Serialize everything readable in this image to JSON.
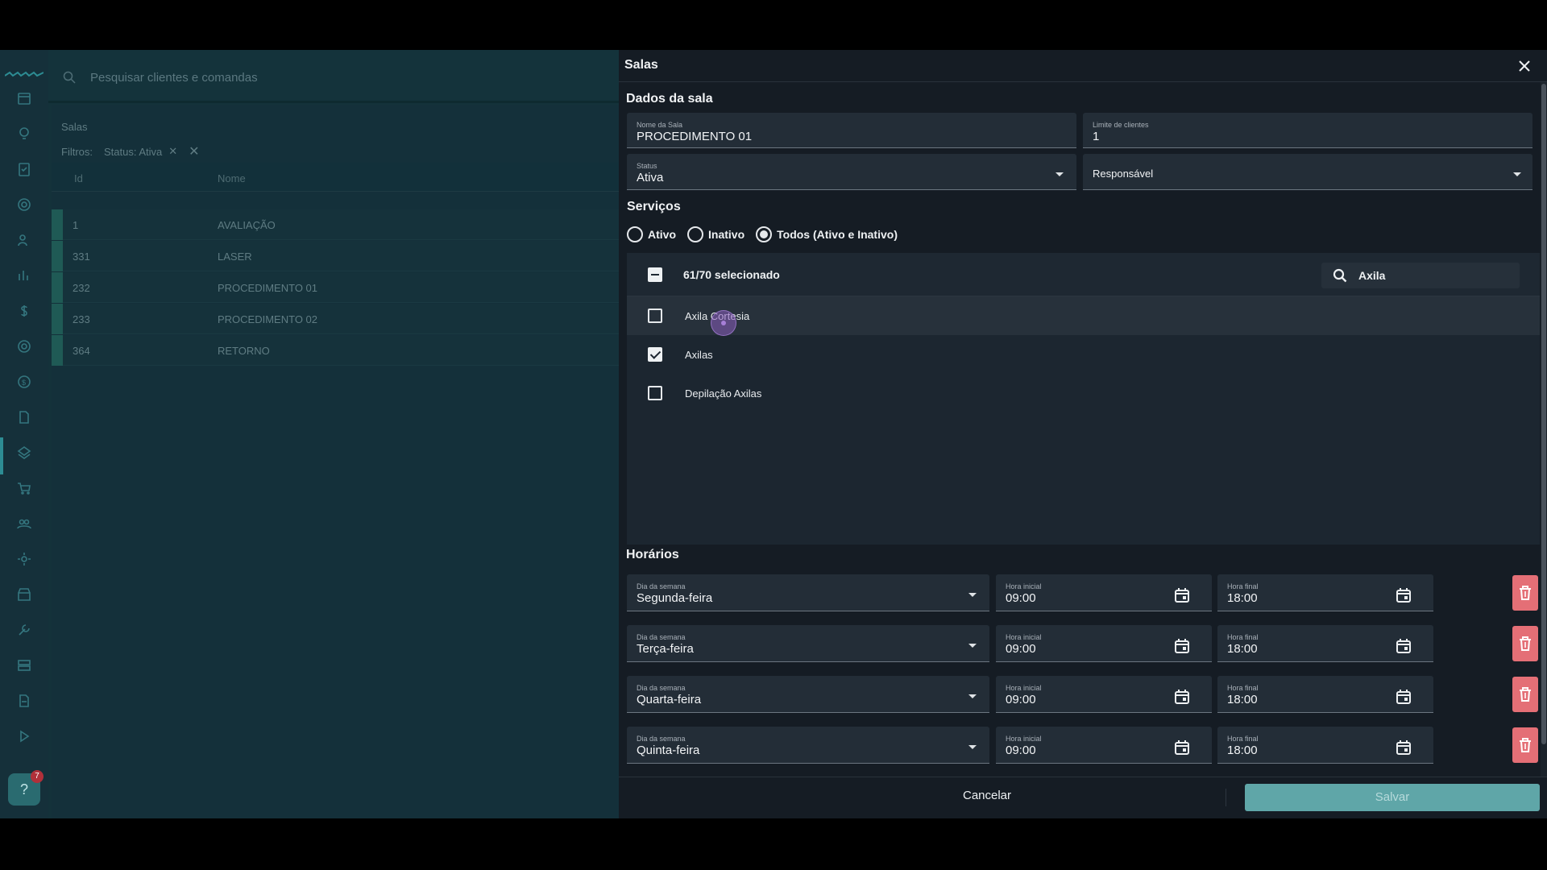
{
  "search": {
    "placeholder": "Pesquisar clientes e comandas"
  },
  "rail": {
    "help_badge": "7"
  },
  "background_page": {
    "title": "Salas",
    "filters_label": "Filtros:",
    "filter_chip": "Status: Ativa",
    "columns": [
      "Id",
      "Nome"
    ],
    "rows": [
      {
        "id": "1",
        "name": "AVALIAÇÃO"
      },
      {
        "id": "331",
        "name": "LASER"
      },
      {
        "id": "232",
        "name": "PROCEDIMENTO 01"
      },
      {
        "id": "233",
        "name": "PROCEDIMENTO 02"
      },
      {
        "id": "364",
        "name": "RETORNO"
      }
    ]
  },
  "modal": {
    "title": "Salas",
    "room_section": "Dados da sala",
    "room_name_label": "Nome da Sala",
    "room_name_value": "PROCEDIMENTO 01",
    "client_limit_label": "Limite de clientes",
    "client_limit_value": "1",
    "status_label": "Status",
    "status_value": "Ativa",
    "responsible_label": "Responsável",
    "services_section": "Serviços",
    "radio_options": [
      "Ativo",
      "Inativo",
      "Todos (Ativo e Inativo)"
    ],
    "radio_selected": "Todos (Ativo e Inativo)",
    "selection_count": "61/70 selecionado",
    "service_search_value": "Axila",
    "services": [
      {
        "name": "Axila Cortesia",
        "checked": false
      },
      {
        "name": "Axilas",
        "checked": true
      },
      {
        "name": "Depilação Axilas",
        "checked": false
      }
    ],
    "schedule_section": "Horários",
    "weekday_label": "Dia da semana",
    "start_label": "Hora inicial",
    "end_label": "Hora final",
    "schedules": [
      {
        "day": "Segunda-feira",
        "start": "09:00",
        "end": "18:00"
      },
      {
        "day": "Terça-feira",
        "start": "09:00",
        "end": "18:00"
      },
      {
        "day": "Quarta-feira",
        "start": "09:00",
        "end": "18:00"
      },
      {
        "day": "Quinta-feira",
        "start": "09:00",
        "end": "18:00"
      }
    ],
    "cancel_label": "Cancelar",
    "save_label": "Salvar"
  },
  "colors": {
    "save_button": "#5fa6a8",
    "delete_button": "#e46f76",
    "modal_bg": "#151c24"
  }
}
